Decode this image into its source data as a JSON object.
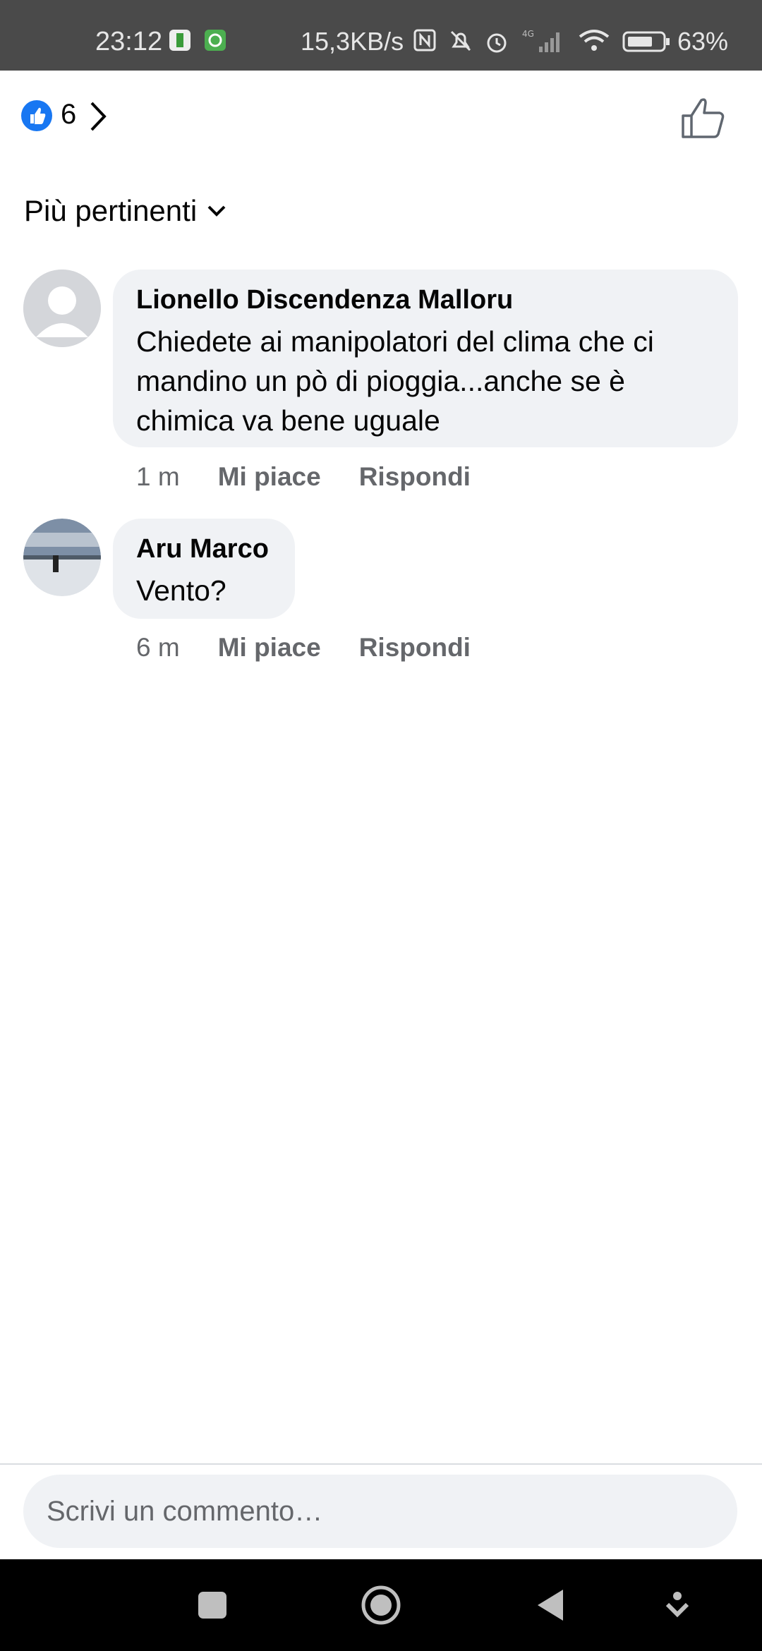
{
  "status_bar": {
    "time": "23:12",
    "net_speed": "15,3KB/s",
    "network": "4G",
    "battery": "63%",
    "icons": [
      "battery-saver-icon",
      "app-notification-icon",
      "nfc-icon",
      "mute-icon",
      "alarm-icon",
      "signal-icon",
      "wifi-icon",
      "battery-icon"
    ]
  },
  "reactions": {
    "count": "6"
  },
  "sort": {
    "label": "Più pertinenti"
  },
  "comments": [
    {
      "author": "Lionello Discendenza Malloru",
      "text": "Chiedete ai manipolatori del clima che ci mandino un pò di pioggia...anche se è chimica va bene uguale",
      "time": "1 m",
      "like_label": "Mi piace",
      "reply_label": "Rispondi"
    },
    {
      "author": "Aru Marco",
      "text": "Vento?",
      "time": "6 m",
      "like_label": "Mi piace",
      "reply_label": "Rispondi"
    }
  ],
  "composer": {
    "placeholder": "Scrivi un commento…"
  },
  "nav": [
    "recents-icon",
    "home-icon",
    "back-icon",
    "menu-down-icon"
  ],
  "colors": {
    "like_blue": "#1877f2",
    "bubble": "#f0f2f5",
    "meta_gray": "#65676b"
  }
}
